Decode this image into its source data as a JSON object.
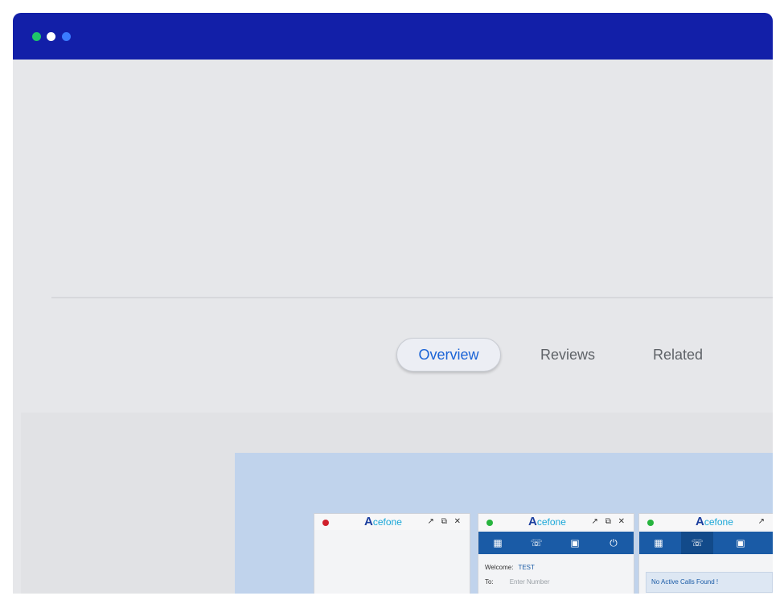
{
  "window": {
    "titlebar_color": "#121fa8",
    "traffic_dots": [
      "#1fc46a",
      "#ffffff",
      "#3a7bff"
    ]
  },
  "tabs": [
    {
      "label": "Overview",
      "active": true
    },
    {
      "label": "Reviews",
      "active": false
    },
    {
      "label": "Related",
      "active": false
    }
  ],
  "preview": {
    "panels": [
      {
        "status": "red",
        "logo_initial": "A",
        "logo_rest": "cefone",
        "controls": "↗ ⧉ ✕"
      },
      {
        "status": "green",
        "logo_initial": "A",
        "logo_rest": "cefone",
        "controls": "↗ ⧉ ✕",
        "welcome_label": "Welcome",
        "welcome_value": "TEST",
        "to_label": "To",
        "to_placeholder": "Enter Number"
      },
      {
        "status": "green",
        "logo_initial": "A",
        "logo_rest": "cefone",
        "controls": "↗",
        "message": "No Active Calls Found !"
      }
    ],
    "toolbar_icons": [
      "dialpad-icon",
      "phone-icon",
      "contacts-icon",
      "power-icon"
    ]
  }
}
